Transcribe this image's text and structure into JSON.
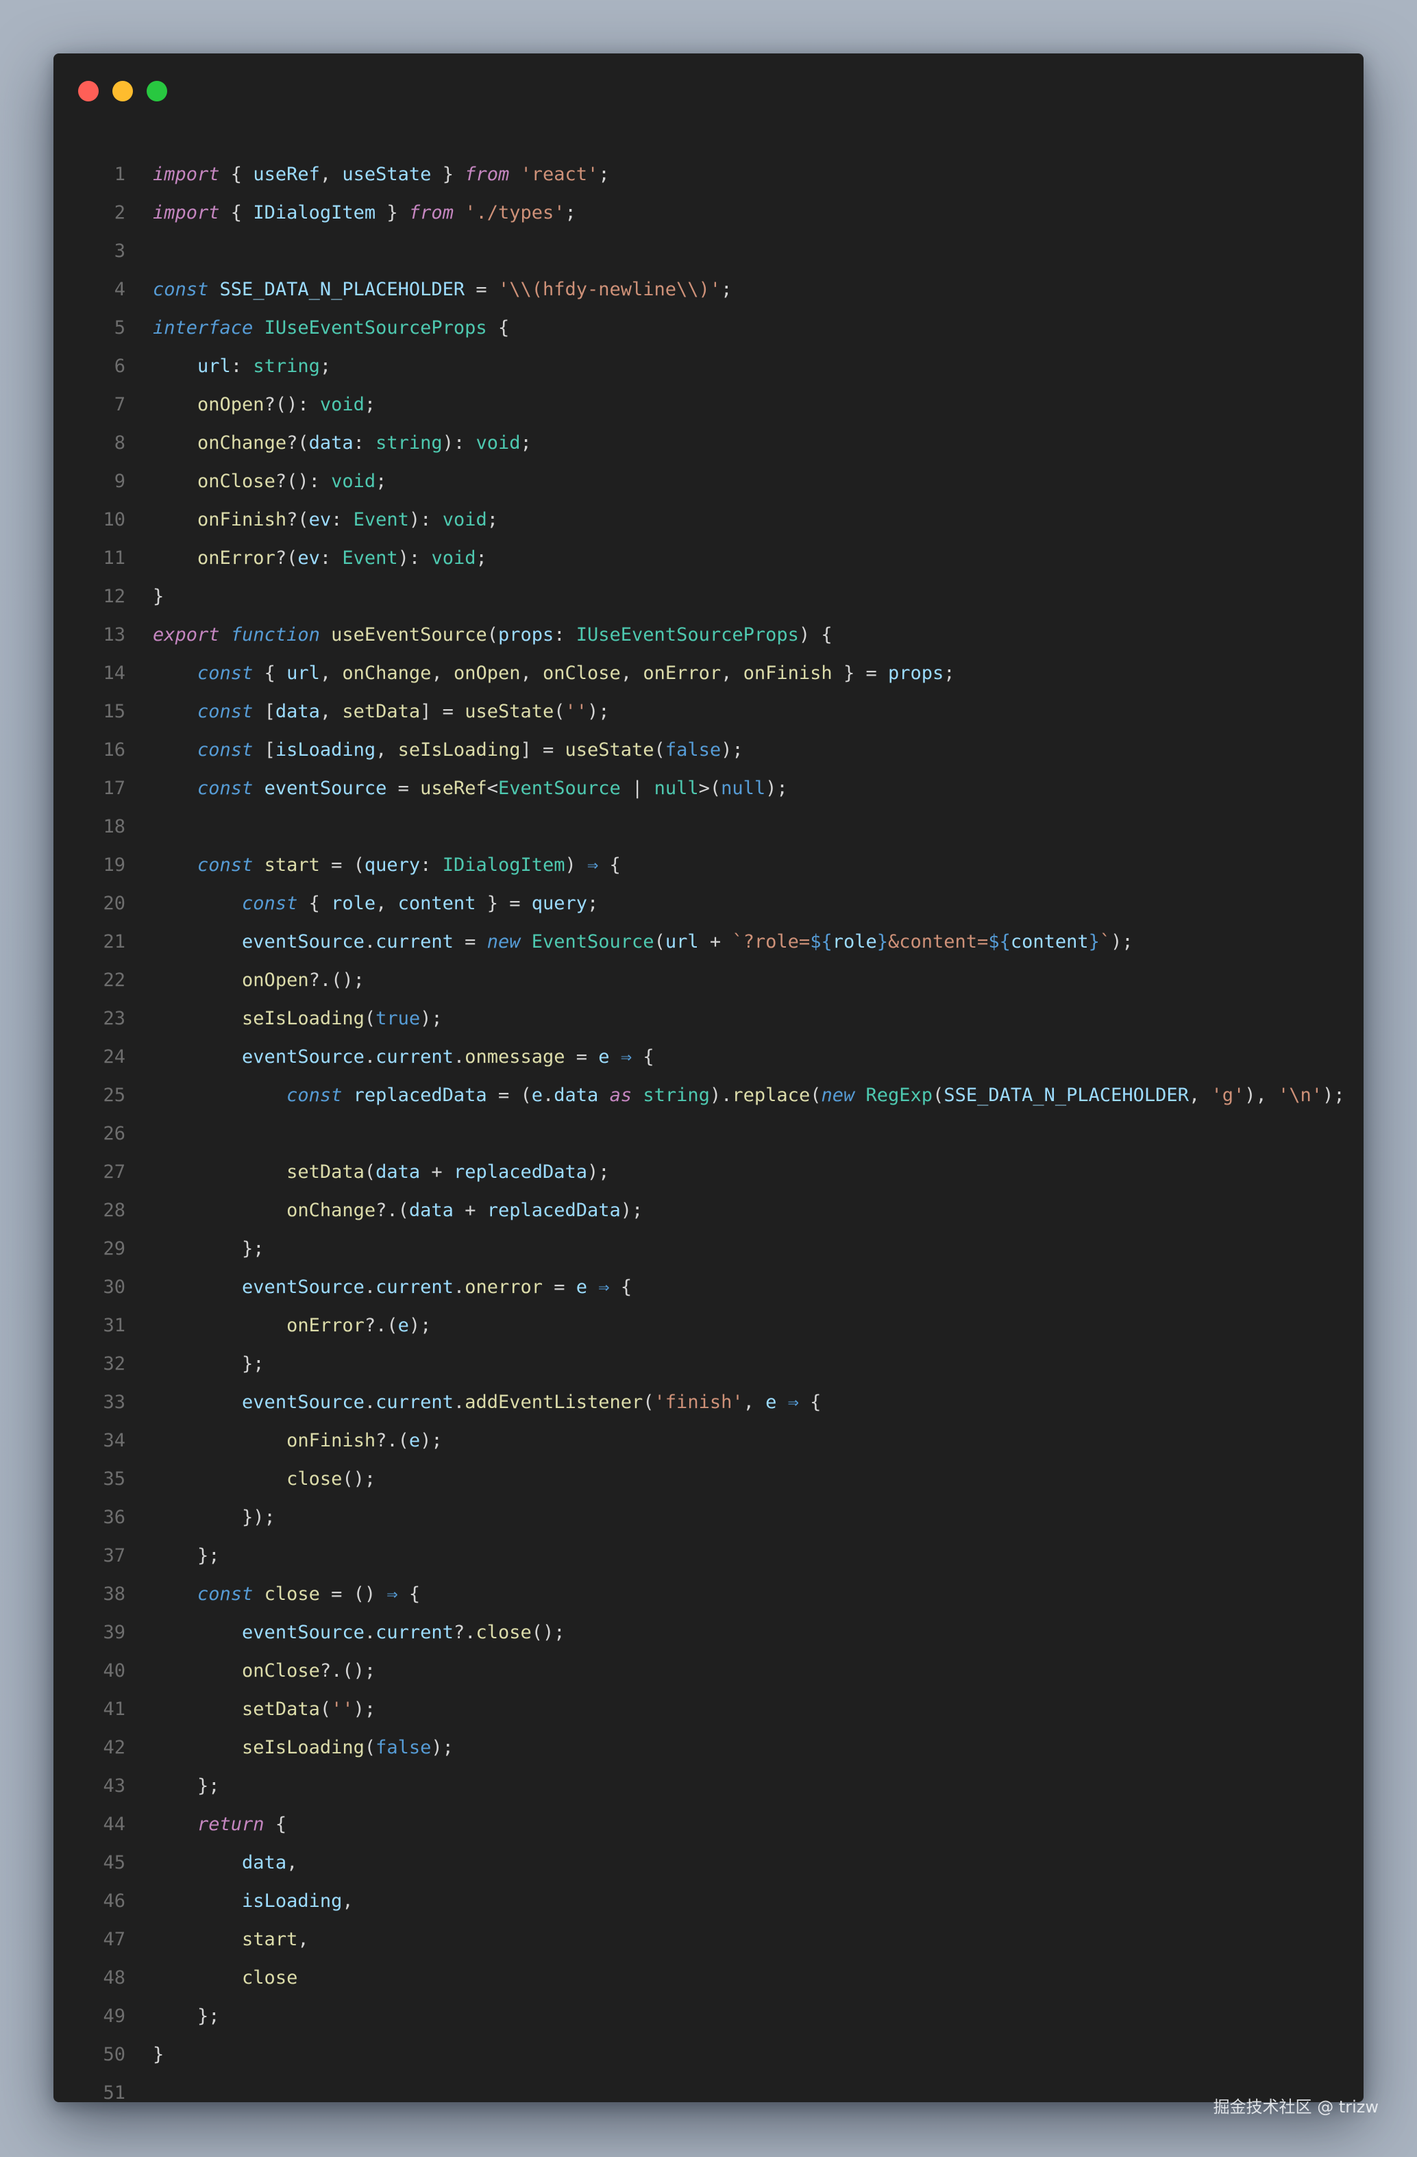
{
  "window": {
    "controls": [
      "close-button",
      "minimize-button",
      "maximize-button"
    ]
  },
  "palette": {
    "kw": "#c586c0",
    "decl": "#569cd6",
    "type": "#4ec9b0",
    "fn": "#dcdcaa",
    "var": "#9cdcfe",
    "str": "#ce9178",
    "plain": "#d4d4d4",
    "num": "#6e6e6e"
  },
  "code_lines": [
    [
      [
        "kw",
        "import",
        "i"
      ],
      [
        "p",
        " { "
      ],
      [
        "var",
        "useRef"
      ],
      [
        "p",
        ", "
      ],
      [
        "var",
        "useState"
      ],
      [
        "p",
        " } "
      ],
      [
        "kw",
        "from",
        "i"
      ],
      [
        "p",
        " "
      ],
      [
        "str",
        "'react'"
      ],
      [
        "p",
        ";"
      ]
    ],
    [
      [
        "kw",
        "import",
        "i"
      ],
      [
        "p",
        " { "
      ],
      [
        "var",
        "IDialogItem"
      ],
      [
        "p",
        " } "
      ],
      [
        "kw",
        "from",
        "i"
      ],
      [
        "p",
        " "
      ],
      [
        "str",
        "'./types'"
      ],
      [
        "p",
        ";"
      ]
    ],
    [],
    [
      [
        "decl",
        "const",
        "i"
      ],
      [
        "p",
        " "
      ],
      [
        "var",
        "SSE_DATA_N_PLACEHOLDER"
      ],
      [
        "p",
        " = "
      ],
      [
        "str",
        "'\\\\(hfdy-newline\\\\)'"
      ],
      [
        "p",
        ";"
      ]
    ],
    [
      [
        "decl",
        "interface",
        "i"
      ],
      [
        "p",
        " "
      ],
      [
        "type",
        "IUseEventSourceProps"
      ],
      [
        "p",
        " {"
      ]
    ],
    [
      [
        "p",
        "    "
      ],
      [
        "var",
        "url"
      ],
      [
        "p",
        ": "
      ],
      [
        "type",
        "string"
      ],
      [
        "p",
        ";"
      ]
    ],
    [
      [
        "p",
        "    "
      ],
      [
        "fn",
        "onOpen"
      ],
      [
        "p",
        "?(): "
      ],
      [
        "type",
        "void"
      ],
      [
        "p",
        ";"
      ]
    ],
    [
      [
        "p",
        "    "
      ],
      [
        "fn",
        "onChange"
      ],
      [
        "p",
        "?("
      ],
      [
        "var",
        "data"
      ],
      [
        "p",
        ": "
      ],
      [
        "type",
        "string"
      ],
      [
        "p",
        "): "
      ],
      [
        "type",
        "void"
      ],
      [
        "p",
        ";"
      ]
    ],
    [
      [
        "p",
        "    "
      ],
      [
        "fn",
        "onClose"
      ],
      [
        "p",
        "?(): "
      ],
      [
        "type",
        "void"
      ],
      [
        "p",
        ";"
      ]
    ],
    [
      [
        "p",
        "    "
      ],
      [
        "fn",
        "onFinish"
      ],
      [
        "p",
        "?("
      ],
      [
        "var",
        "ev"
      ],
      [
        "p",
        ": "
      ],
      [
        "type",
        "Event"
      ],
      [
        "p",
        "): "
      ],
      [
        "type",
        "void"
      ],
      [
        "p",
        ";"
      ]
    ],
    [
      [
        "p",
        "    "
      ],
      [
        "fn",
        "onError"
      ],
      [
        "p",
        "?("
      ],
      [
        "var",
        "ev"
      ],
      [
        "p",
        ": "
      ],
      [
        "type",
        "Event"
      ],
      [
        "p",
        "): "
      ],
      [
        "type",
        "void"
      ],
      [
        "p",
        ";"
      ]
    ],
    [
      [
        "p",
        "}"
      ]
    ],
    [
      [
        "kw",
        "export",
        "i"
      ],
      [
        "p",
        " "
      ],
      [
        "decl",
        "function",
        "i"
      ],
      [
        "p",
        " "
      ],
      [
        "fn",
        "useEventSource"
      ],
      [
        "p",
        "("
      ],
      [
        "var",
        "props"
      ],
      [
        "p",
        ": "
      ],
      [
        "type",
        "IUseEventSourceProps"
      ],
      [
        "p",
        ") {"
      ]
    ],
    [
      [
        "p",
        "    "
      ],
      [
        "decl",
        "const",
        "i"
      ],
      [
        "p",
        " { "
      ],
      [
        "var",
        "url"
      ],
      [
        "p",
        ", "
      ],
      [
        "fn",
        "onChange"
      ],
      [
        "p",
        ", "
      ],
      [
        "fn",
        "onOpen"
      ],
      [
        "p",
        ", "
      ],
      [
        "fn",
        "onClose"
      ],
      [
        "p",
        ", "
      ],
      [
        "fn",
        "onError"
      ],
      [
        "p",
        ", "
      ],
      [
        "fn",
        "onFinish"
      ],
      [
        "p",
        " } = "
      ],
      [
        "var",
        "props"
      ],
      [
        "p",
        ";"
      ]
    ],
    [
      [
        "p",
        "    "
      ],
      [
        "decl",
        "const",
        "i"
      ],
      [
        "p",
        " ["
      ],
      [
        "var",
        "data"
      ],
      [
        "p",
        ", "
      ],
      [
        "fn",
        "setData"
      ],
      [
        "p",
        "] = "
      ],
      [
        "fn",
        "useState"
      ],
      [
        "p",
        "("
      ],
      [
        "str",
        "''"
      ],
      [
        "p",
        ");"
      ]
    ],
    [
      [
        "p",
        "    "
      ],
      [
        "decl",
        "const",
        "i"
      ],
      [
        "p",
        " ["
      ],
      [
        "var",
        "isLoading"
      ],
      [
        "p",
        ", "
      ],
      [
        "fn",
        "seIsLoading"
      ],
      [
        "p",
        "] = "
      ],
      [
        "fn",
        "useState"
      ],
      [
        "p",
        "("
      ],
      [
        "decl",
        "false"
      ],
      [
        "p",
        ");"
      ]
    ],
    [
      [
        "p",
        "    "
      ],
      [
        "decl",
        "const",
        "i"
      ],
      [
        "p",
        " "
      ],
      [
        "var",
        "eventSource"
      ],
      [
        "p",
        " = "
      ],
      [
        "fn",
        "useRef"
      ],
      [
        "p",
        "<"
      ],
      [
        "type",
        "EventSource"
      ],
      [
        "p",
        " | "
      ],
      [
        "type",
        "null"
      ],
      [
        "p",
        ">("
      ],
      [
        "decl",
        "null"
      ],
      [
        "p",
        ");"
      ]
    ],
    [],
    [
      [
        "p",
        "    "
      ],
      [
        "decl",
        "const",
        "i"
      ],
      [
        "p",
        " "
      ],
      [
        "fn",
        "start"
      ],
      [
        "p",
        " = ("
      ],
      [
        "var",
        "query"
      ],
      [
        "p",
        ": "
      ],
      [
        "type",
        "IDialogItem"
      ],
      [
        "p",
        ") "
      ],
      [
        "decl",
        "⇒"
      ],
      [
        "p",
        " {"
      ]
    ],
    [
      [
        "p",
        "        "
      ],
      [
        "decl",
        "const",
        "i"
      ],
      [
        "p",
        " { "
      ],
      [
        "var",
        "role"
      ],
      [
        "p",
        ", "
      ],
      [
        "var",
        "content"
      ],
      [
        "p",
        " } = "
      ],
      [
        "var",
        "query"
      ],
      [
        "p",
        ";"
      ]
    ],
    [
      [
        "p",
        "        "
      ],
      [
        "var",
        "eventSource"
      ],
      [
        "p",
        "."
      ],
      [
        "var",
        "current"
      ],
      [
        "p",
        " = "
      ],
      [
        "decl",
        "new",
        "i"
      ],
      [
        "p",
        " "
      ],
      [
        "type",
        "EventSource"
      ],
      [
        "p",
        "("
      ],
      [
        "var",
        "url"
      ],
      [
        "p",
        " + "
      ],
      [
        "str",
        "`?role="
      ],
      [
        "decl",
        "${"
      ],
      [
        "var",
        "role"
      ],
      [
        "decl",
        "}"
      ],
      [
        "str",
        "&content="
      ],
      [
        "decl",
        "${"
      ],
      [
        "var",
        "content"
      ],
      [
        "decl",
        "}"
      ],
      [
        "str",
        "`"
      ],
      [
        "p",
        ");"
      ]
    ],
    [
      [
        "p",
        "        "
      ],
      [
        "fn",
        "onOpen"
      ],
      [
        "p",
        "?.();"
      ]
    ],
    [
      [
        "p",
        "        "
      ],
      [
        "fn",
        "seIsLoading"
      ],
      [
        "p",
        "("
      ],
      [
        "decl",
        "true"
      ],
      [
        "p",
        ");"
      ]
    ],
    [
      [
        "p",
        "        "
      ],
      [
        "var",
        "eventSource"
      ],
      [
        "p",
        "."
      ],
      [
        "var",
        "current"
      ],
      [
        "p",
        "."
      ],
      [
        "fn",
        "onmessage"
      ],
      [
        "p",
        " = "
      ],
      [
        "var",
        "e"
      ],
      [
        "p",
        " "
      ],
      [
        "decl",
        "⇒"
      ],
      [
        "p",
        " {"
      ]
    ],
    [
      [
        "p",
        "            "
      ],
      [
        "decl",
        "const",
        "i"
      ],
      [
        "p",
        " "
      ],
      [
        "var",
        "replacedData"
      ],
      [
        "p",
        " = ("
      ],
      [
        "var",
        "e"
      ],
      [
        "p",
        "."
      ],
      [
        "var",
        "data"
      ],
      [
        "p",
        " "
      ],
      [
        "kw",
        "as",
        "i"
      ],
      [
        "p",
        " "
      ],
      [
        "type",
        "string"
      ],
      [
        "p",
        ")."
      ],
      [
        "fn",
        "replace"
      ],
      [
        "p",
        "("
      ],
      [
        "decl",
        "new",
        "i"
      ],
      [
        "p",
        " "
      ],
      [
        "type",
        "RegExp"
      ],
      [
        "p",
        "("
      ],
      [
        "var",
        "SSE_DATA_N_PLACEHOLDER"
      ],
      [
        "p",
        ", "
      ],
      [
        "str",
        "'g'"
      ],
      [
        "p",
        "), "
      ],
      [
        "str",
        "'\\n'"
      ],
      [
        "p",
        ");"
      ]
    ],
    [],
    [
      [
        "p",
        "            "
      ],
      [
        "fn",
        "setData"
      ],
      [
        "p",
        "("
      ],
      [
        "var",
        "data"
      ],
      [
        "p",
        " + "
      ],
      [
        "var",
        "replacedData"
      ],
      [
        "p",
        ");"
      ]
    ],
    [
      [
        "p",
        "            "
      ],
      [
        "fn",
        "onChange"
      ],
      [
        "p",
        "?.("
      ],
      [
        "var",
        "data"
      ],
      [
        "p",
        " + "
      ],
      [
        "var",
        "replacedData"
      ],
      [
        "p",
        ");"
      ]
    ],
    [
      [
        "p",
        "        };"
      ]
    ],
    [
      [
        "p",
        "        "
      ],
      [
        "var",
        "eventSource"
      ],
      [
        "p",
        "."
      ],
      [
        "var",
        "current"
      ],
      [
        "p",
        "."
      ],
      [
        "fn",
        "onerror"
      ],
      [
        "p",
        " = "
      ],
      [
        "var",
        "e"
      ],
      [
        "p",
        " "
      ],
      [
        "decl",
        "⇒"
      ],
      [
        "p",
        " {"
      ]
    ],
    [
      [
        "p",
        "            "
      ],
      [
        "fn",
        "onError"
      ],
      [
        "p",
        "?.("
      ],
      [
        "var",
        "e"
      ],
      [
        "p",
        ");"
      ]
    ],
    [
      [
        "p",
        "        };"
      ]
    ],
    [
      [
        "p",
        "        "
      ],
      [
        "var",
        "eventSource"
      ],
      [
        "p",
        "."
      ],
      [
        "var",
        "current"
      ],
      [
        "p",
        "."
      ],
      [
        "fn",
        "addEventListener"
      ],
      [
        "p",
        "("
      ],
      [
        "str",
        "'finish'"
      ],
      [
        "p",
        ", "
      ],
      [
        "var",
        "e"
      ],
      [
        "p",
        " "
      ],
      [
        "decl",
        "⇒"
      ],
      [
        "p",
        " {"
      ]
    ],
    [
      [
        "p",
        "            "
      ],
      [
        "fn",
        "onFinish"
      ],
      [
        "p",
        "?.("
      ],
      [
        "var",
        "e"
      ],
      [
        "p",
        ");"
      ]
    ],
    [
      [
        "p",
        "            "
      ],
      [
        "fn",
        "close"
      ],
      [
        "p",
        "();"
      ]
    ],
    [
      [
        "p",
        "        });"
      ]
    ],
    [
      [
        "p",
        "    };"
      ]
    ],
    [
      [
        "p",
        "    "
      ],
      [
        "decl",
        "const",
        "i"
      ],
      [
        "p",
        " "
      ],
      [
        "fn",
        "close"
      ],
      [
        "p",
        " = () "
      ],
      [
        "decl",
        "⇒"
      ],
      [
        "p",
        " {"
      ]
    ],
    [
      [
        "p",
        "        "
      ],
      [
        "var",
        "eventSource"
      ],
      [
        "p",
        "."
      ],
      [
        "var",
        "current"
      ],
      [
        "p",
        "?."
      ],
      [
        "fn",
        "close"
      ],
      [
        "p",
        "();"
      ]
    ],
    [
      [
        "p",
        "        "
      ],
      [
        "fn",
        "onClose"
      ],
      [
        "p",
        "?.();"
      ]
    ],
    [
      [
        "p",
        "        "
      ],
      [
        "fn",
        "setData"
      ],
      [
        "p",
        "("
      ],
      [
        "str",
        "''"
      ],
      [
        "p",
        ");"
      ]
    ],
    [
      [
        "p",
        "        "
      ],
      [
        "fn",
        "seIsLoading"
      ],
      [
        "p",
        "("
      ],
      [
        "decl",
        "false"
      ],
      [
        "p",
        ");"
      ]
    ],
    [
      [
        "p",
        "    };"
      ]
    ],
    [
      [
        "p",
        "    "
      ],
      [
        "kw",
        "return",
        "i"
      ],
      [
        "p",
        " {"
      ]
    ],
    [
      [
        "p",
        "        "
      ],
      [
        "var",
        "data"
      ],
      [
        "p",
        ","
      ]
    ],
    [
      [
        "p",
        "        "
      ],
      [
        "var",
        "isLoading"
      ],
      [
        "p",
        ","
      ]
    ],
    [
      [
        "p",
        "        "
      ],
      [
        "fn",
        "start"
      ],
      [
        "p",
        ","
      ]
    ],
    [
      [
        "p",
        "        "
      ],
      [
        "fn",
        "close"
      ]
    ],
    [
      [
        "p",
        "    };"
      ]
    ],
    [
      [
        "p",
        "}"
      ]
    ],
    []
  ],
  "watermark": "掘金技术社区 @ trizw"
}
